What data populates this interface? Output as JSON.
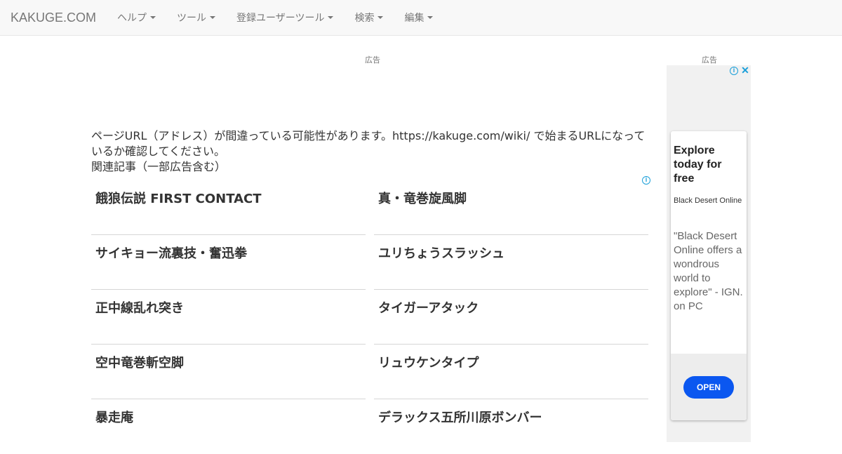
{
  "navbar": {
    "brand": "KAKUGE.COM",
    "menu": [
      {
        "label": "ヘルプ"
      },
      {
        "label": "ツール"
      },
      {
        "label": "登録ユーザーツール"
      },
      {
        "label": "検索"
      },
      {
        "label": "編集"
      }
    ]
  },
  "ads": {
    "top_label": "広告",
    "side_label": "広告",
    "side": {
      "headline": "Explore today for free",
      "advertiser": "Black Desert Online",
      "body": "\"Black Desert Online offers a wondrous world to explore\" - IGN. on PC",
      "cta": "OPEN"
    }
  },
  "main": {
    "message": "ページURL（アドレス）が間違っている可能性があります。https://kakuge.com/wiki/ で始まるURLになっているか確認してください。",
    "related_heading": "関連記事（一部広告含む）",
    "related": [
      {
        "title": "餓狼伝説 FIRST CONTACT"
      },
      {
        "title": "真・竜巻旋風脚"
      },
      {
        "title": "サイキョー流裏技・奮迅拳"
      },
      {
        "title": "ユリちょうスラッシュ"
      },
      {
        "title": "正中線乱れ突き"
      },
      {
        "title": "タイガーアタック"
      },
      {
        "title": "空中竜巻斬空脚"
      },
      {
        "title": "リュウケンタイプ"
      },
      {
        "title": "暴走庵"
      },
      {
        "title": "デラックス五所川原ボンバー"
      }
    ]
  },
  "colors": {
    "navbar_bg": "#f8f8f8",
    "accent": "#0b57f0",
    "ad_icon": "#1a9fd9"
  }
}
